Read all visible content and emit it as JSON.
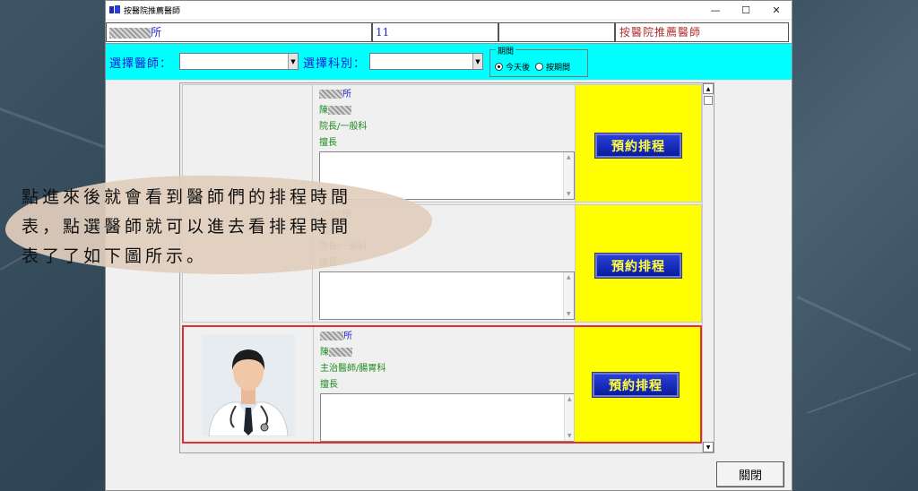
{
  "window": {
    "title": "按醫院推薦醫師",
    "minimize_glyph": "—",
    "maximize_glyph": "☐",
    "close_glyph": "✕"
  },
  "info_row": {
    "clinic_suffix": "所",
    "count": "11",
    "empty_cell": "",
    "mode_label": "按醫院推薦醫師"
  },
  "filters": {
    "doctor_label": "選擇醫師：",
    "doctor_value": "",
    "specialty_label": "選擇科別：",
    "specialty_value": "",
    "period_legend": "期間",
    "period_options": [
      {
        "label": "今天後",
        "selected": true
      },
      {
        "label": "按期間",
        "selected": false
      }
    ]
  },
  "doctors": [
    {
      "clinic": "所",
      "name_prefix": "陳",
      "title_specialty": "院長/一般科",
      "specialty_heading": "擅長",
      "notes": "",
      "book_label": "預約排程",
      "has_photo": false,
      "selected": false
    },
    {
      "clinic": "所",
      "name_prefix": "",
      "title_specialty": "院長/一般科",
      "specialty_heading": "擅長",
      "notes": "",
      "book_label": "預約排程",
      "has_photo": false,
      "selected": false
    },
    {
      "clinic": "所",
      "name_prefix": "陳",
      "title_specialty": "主治醫師/腸胃科",
      "specialty_heading": "擅長",
      "notes": "",
      "book_label": "預約排程",
      "has_photo": true,
      "selected": true
    }
  ],
  "close_button": "關閉",
  "annotation": {
    "line1": "點進來後就會看到醫師們的排程時間",
    "line2": "表，點選醫師就可以進去看排程時間",
    "line3": "表了了如下圖所示。"
  },
  "colors": {
    "filter_bar": "#00ffff",
    "book_panel": "#ffff00",
    "selected_border": "#e03030",
    "label_blue": "#1a1ad0",
    "mode_red": "#b03030"
  }
}
